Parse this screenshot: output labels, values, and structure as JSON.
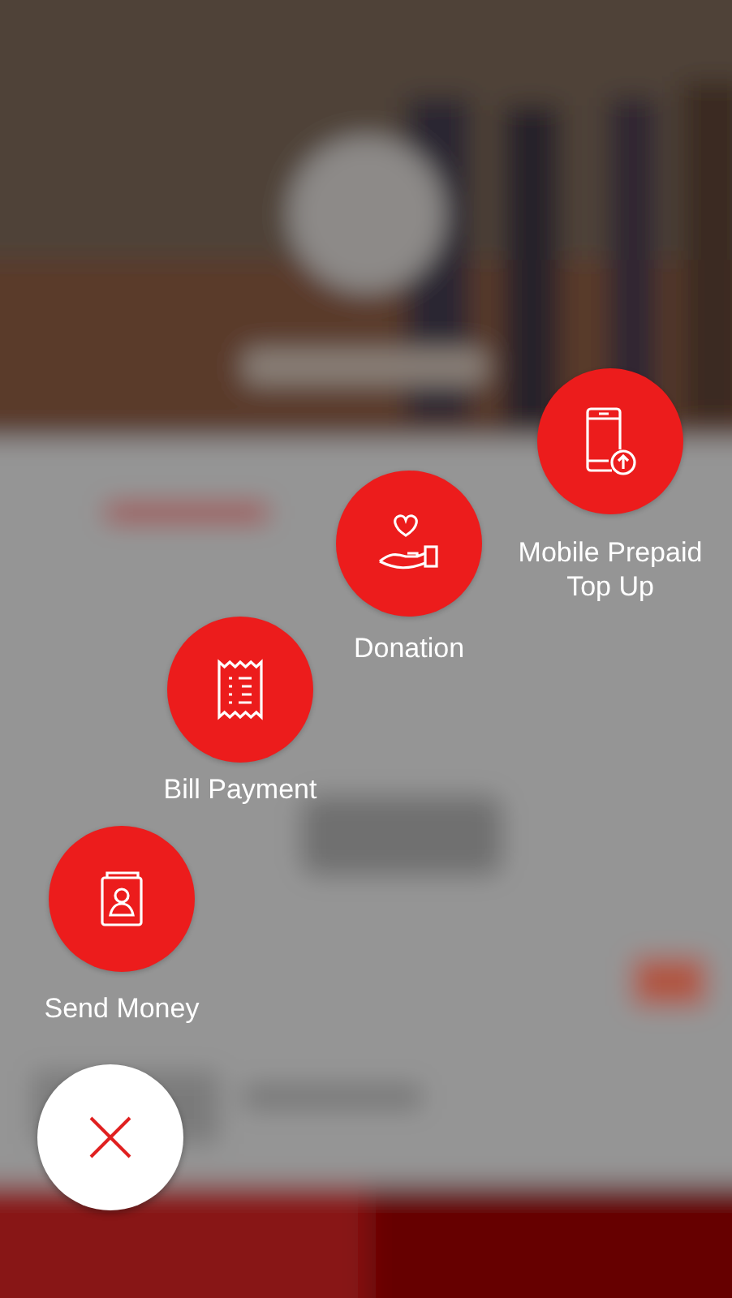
{
  "actions": [
    {
      "kind": "send",
      "label": "Send Money"
    },
    {
      "kind": "bill",
      "label": "Bill Payment"
    },
    {
      "kind": "donation",
      "label": "Donation"
    },
    {
      "kind": "topup",
      "label": "Mobile Prepaid Top Up"
    }
  ]
}
